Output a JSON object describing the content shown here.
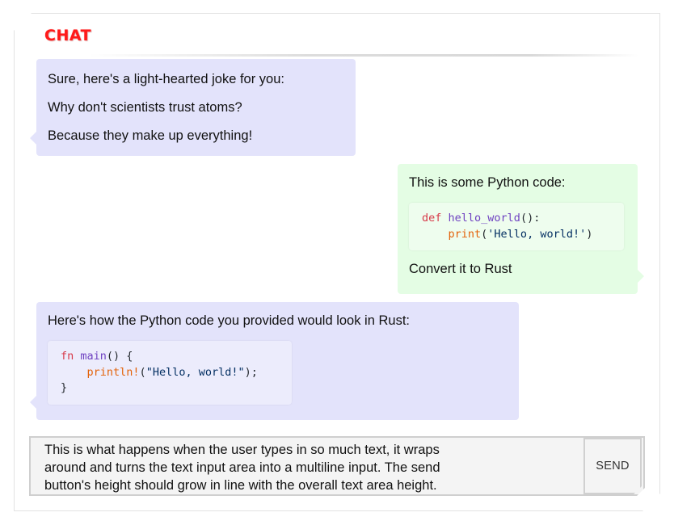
{
  "header": {
    "title": "CHAT"
  },
  "messages": [
    {
      "role": "assistant",
      "paragraphs": [
        "Sure, here's a light-hearted joke for you:",
        "Why don't scientists trust atoms?",
        "Because they make up everything!"
      ]
    },
    {
      "role": "user",
      "intro": "This is some Python code:",
      "code": {
        "language": "python",
        "line1": {
          "kw": "def",
          "fn": "hello_world",
          "rest": "():"
        },
        "line2": {
          "indent": "    ",
          "bi": "print",
          "open": "(",
          "str": "'Hello, world!'",
          "close": ")"
        }
      },
      "outro": "Convert it to Rust"
    },
    {
      "role": "assistant",
      "intro": "Here's how the Python code you provided would look in Rust:",
      "code": {
        "language": "rust",
        "line1": {
          "kw": "fn",
          "fn": "main",
          "rest": "() {"
        },
        "line2": {
          "indent": "    ",
          "macro": "println!",
          "open": "(",
          "str": "\"Hello, world!\"",
          "close": ");"
        },
        "line3": "}"
      }
    }
  ],
  "composer": {
    "text": "This is what happens when the user types in so much text, it wraps\naround and turns the text input area into a multiline input. The send\nbutton's height should grow in line with the overall text area height.",
    "send_label": "SEND"
  },
  "colors": {
    "title": "#ff1a1a",
    "assistant_bubble": "#e3e3fb",
    "user_bubble": "#e4fde4",
    "keyword": "#d73a49",
    "function": "#6f42c1",
    "builtin": "#e36209",
    "string": "#032f62"
  }
}
